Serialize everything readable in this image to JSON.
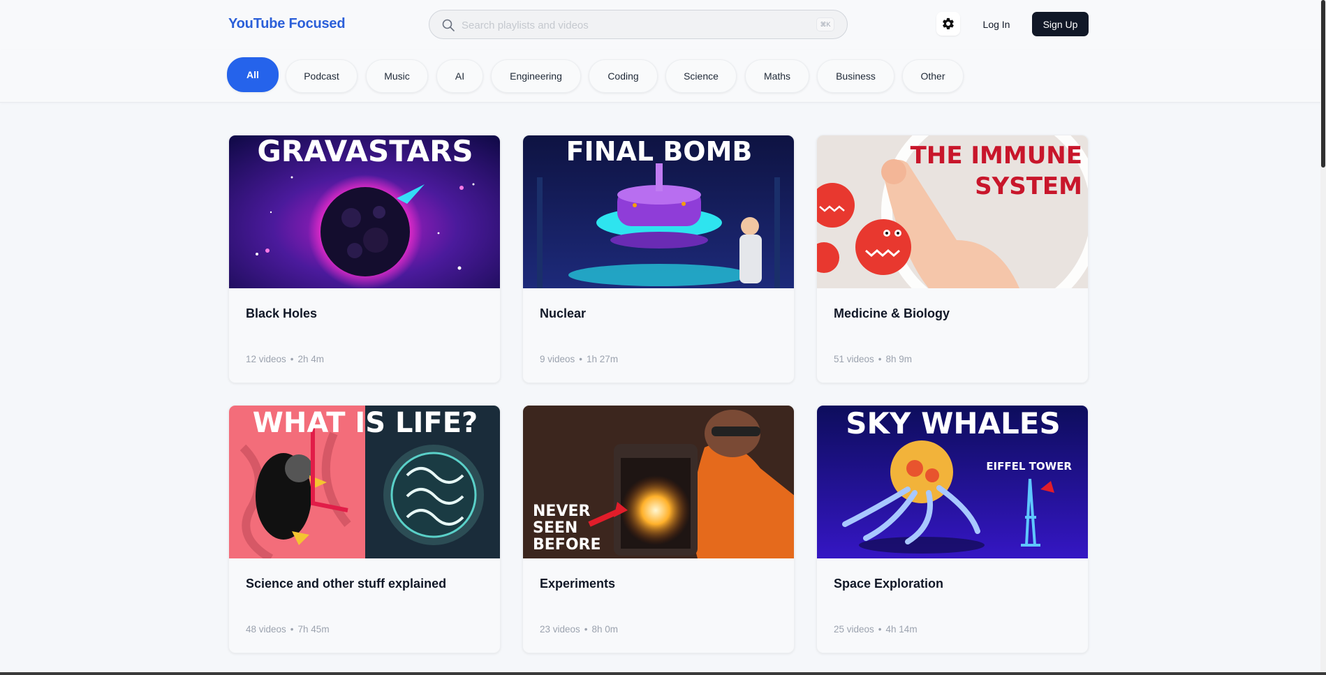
{
  "header": {
    "brand": "YouTube Focused",
    "search_placeholder": "Search playlists and videos",
    "search_shortcut": "⌘K",
    "settings_icon": "gear-icon",
    "login_label": "Log In",
    "signup_label": "Sign Up",
    "brand_color": "#2b5fd9"
  },
  "categories": {
    "active": "All",
    "active_color": "#2563eb",
    "items": [
      "All",
      "Podcast",
      "Music",
      "AI",
      "Engineering",
      "Coding",
      "Science",
      "Maths",
      "Business",
      "Other"
    ]
  },
  "playlists": [
    {
      "thumb_text": "GRAVASTARS",
      "title": "Black Holes",
      "videos": "12 videos",
      "duration": "2h 4m"
    },
    {
      "thumb_text": "FINAL BOMB",
      "title": "Nuclear",
      "videos": "9 videos",
      "duration": "1h 27m"
    },
    {
      "thumb_text": "THE IMMUNE SYSTEM",
      "thumb_line1": "THE IMMUNE",
      "thumb_line2": "SYSTEM",
      "title": "Medicine & Biology",
      "videos": "51 videos",
      "duration": "8h 9m"
    },
    {
      "thumb_text": "WHAT IS LIFE?",
      "title": "Science and other stuff explained",
      "videos": "48 videos",
      "duration": "7h 45m"
    },
    {
      "thumb_text": "NEVER SEEN BEFORE",
      "thumb_line1": "NEVER",
      "thumb_line2": "SEEN",
      "thumb_line3": "BEFORE",
      "title": "Experiments",
      "videos": "23 videos",
      "duration": "8h 0m"
    },
    {
      "thumb_text": "SKY WHALES",
      "thumb_sub": "EIFFEL TOWER",
      "title": "Space Exploration",
      "videos": "25 videos",
      "duration": "4h 14m"
    }
  ],
  "meta_separator": "•"
}
